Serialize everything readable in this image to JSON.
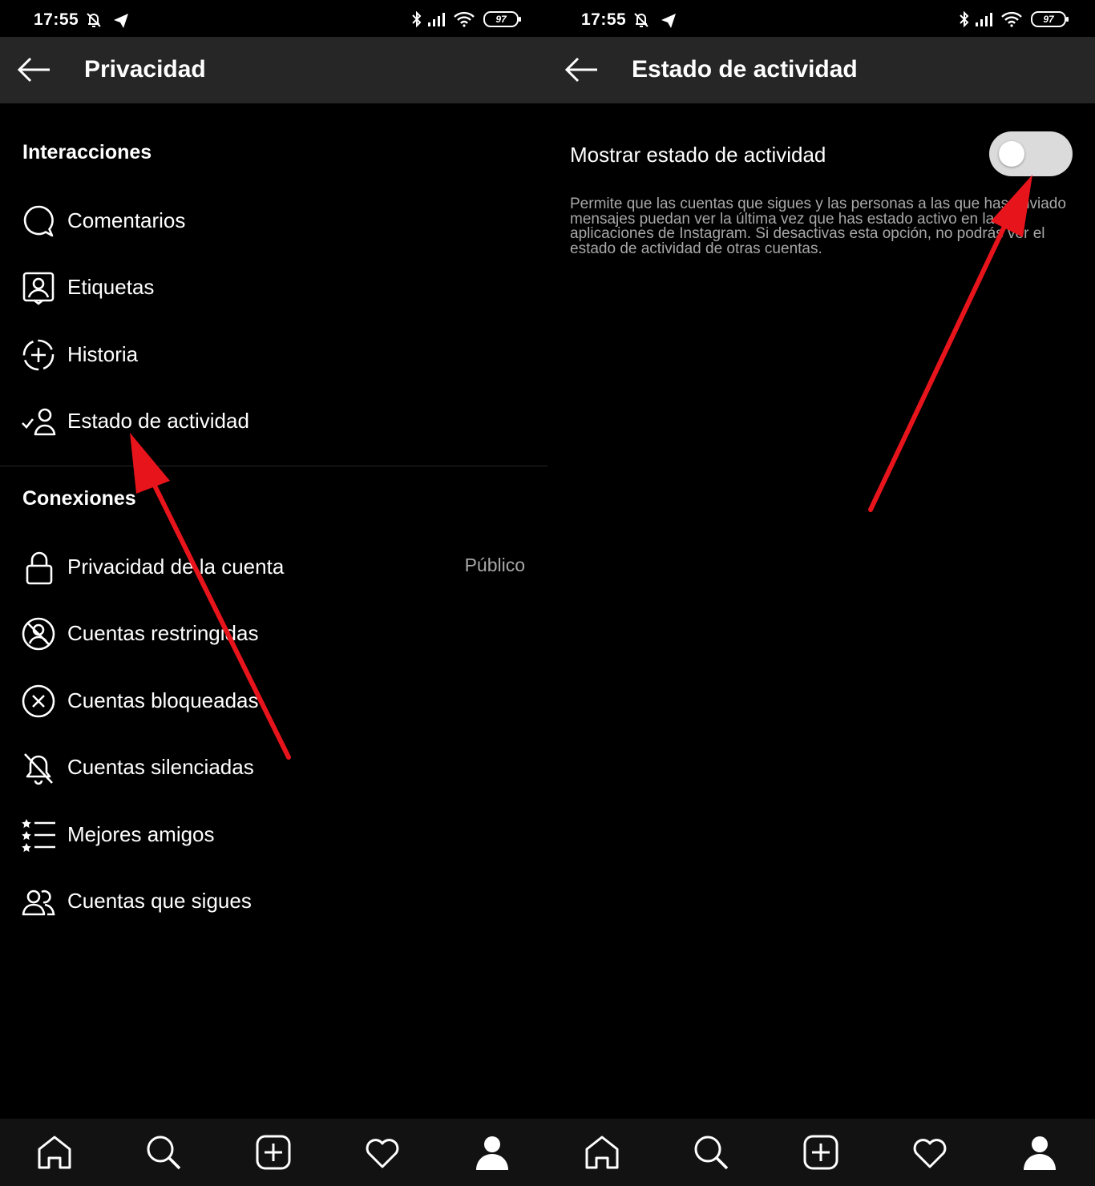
{
  "status_bar": {
    "time": "17:55",
    "battery": "97"
  },
  "left_screen": {
    "title": "Privacidad",
    "sections": [
      {
        "title": "Interacciones",
        "items": [
          {
            "label": "Comentarios",
            "icon": "comment-icon"
          },
          {
            "label": "Etiquetas",
            "icon": "tag-person-icon"
          },
          {
            "label": "Historia",
            "icon": "story-add-icon"
          },
          {
            "label": "Estado de actividad",
            "icon": "activity-status-icon"
          }
        ]
      },
      {
        "title": "Conexiones",
        "items": [
          {
            "label": "Privacidad de la cuenta",
            "value": "Público",
            "icon": "lock-icon"
          },
          {
            "label": "Cuentas restringidas",
            "icon": "restricted-icon"
          },
          {
            "label": "Cuentas bloqueadas",
            "icon": "blocked-icon"
          },
          {
            "label": "Cuentas silenciadas",
            "icon": "muted-bell-icon"
          },
          {
            "label": "Mejores amigos",
            "icon": "close-friends-list-icon"
          },
          {
            "label": "Cuentas que sigues",
            "icon": "following-people-icon"
          }
        ]
      }
    ]
  },
  "right_screen": {
    "title": "Estado de actividad",
    "toggle_label": "Mostrar estado de actividad",
    "toggle_on": false,
    "description": "Permite que las cuentas que sigues y las personas a las que has enviado mensajes puedan ver la última vez que has estado activo en las aplicaciones de Instagram. Si desactivas esta opción, no podrás ver el estado de actividad de otras cuentas."
  },
  "bottom_nav": [
    "home-icon",
    "search-icon",
    "new-post-icon",
    "activity-heart-icon",
    "profile-icon"
  ],
  "colors": {
    "background": "#000000",
    "topbar": "#262626",
    "muted_text": "#a8a8a8",
    "toggle_off": "#dbdbdb",
    "annotation_arrow": "#e8141b"
  }
}
